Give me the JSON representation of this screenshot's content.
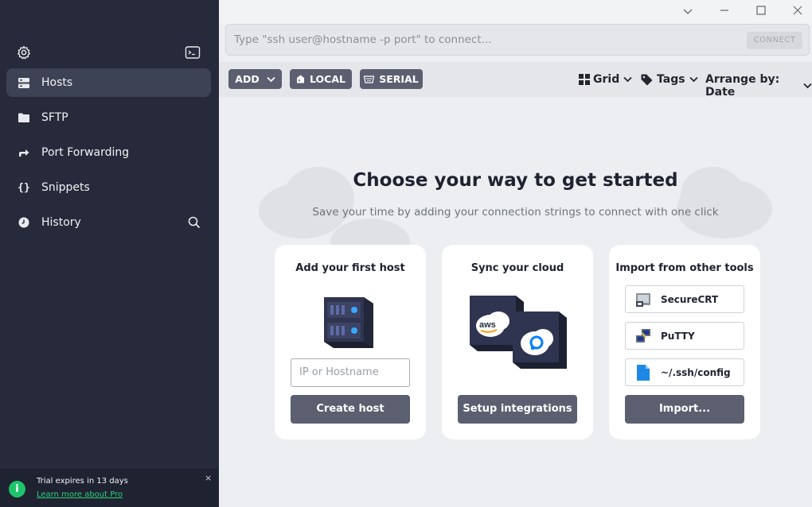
{
  "sidebar": {
    "items": [
      {
        "label": "Hosts",
        "icon": "hosts-icon"
      },
      {
        "label": "SFTP",
        "icon": "folder-icon"
      },
      {
        "label": "Port Forwarding",
        "icon": "port-forwarding-icon"
      },
      {
        "label": "Snippets",
        "icon": "braces-icon"
      },
      {
        "label": "History",
        "icon": "clock-icon"
      }
    ],
    "active_index": 0
  },
  "trial": {
    "text": "Trial expires in 13 days",
    "link": "Learn more about Pro",
    "close": "×"
  },
  "connect": {
    "placeholder": "Type \"ssh user@hostname -p port\" to connect...",
    "button": "CONNECT"
  },
  "toolbar": {
    "add": "ADD",
    "local": "LOCAL",
    "serial": "SERIAL",
    "grid": "Grid",
    "tags": "Tags",
    "arrange": "Arrange by: Date"
  },
  "main": {
    "heading": "Choose your way to get started",
    "subheading": "Save your time by adding your connection strings to connect with one click"
  },
  "cards": {
    "host": {
      "title": "Add your first host",
      "input_placeholder": "IP or Hostname",
      "button": "Create host"
    },
    "cloud": {
      "title": "Sync your cloud",
      "button": "Setup integrations",
      "aws_label": "aws"
    },
    "import": {
      "title": "Import from other tools",
      "tools": [
        "SecureCRT",
        "PuTTY",
        "~/.ssh/config"
      ],
      "button": "Import..."
    }
  },
  "colors": {
    "sidebar_bg": "#262a3a",
    "accent_green": "#1ec46b",
    "button_dark": "#5b5f70"
  }
}
